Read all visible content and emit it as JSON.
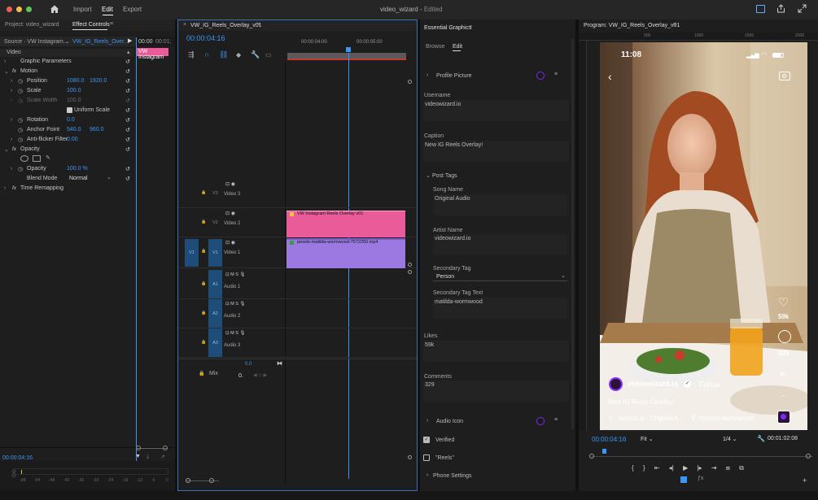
{
  "titlebar": {
    "import": "Import",
    "edit": "Edit",
    "export": "Export",
    "project": "video_wizard",
    "sep": "-",
    "status": "Edited"
  },
  "project_panel": {
    "label": "Project: video_wizard",
    "effect_controls": "Effect Controls"
  },
  "effect_controls": {
    "source": "Source · VW Instagram...",
    "sequence": "VW_IG_Reels_Over...",
    "time1": "00:00",
    "time2": "00:01;",
    "clip_label": "VW Instagram",
    "section_video": "Video",
    "rows": [
      {
        "name": "Graphic Parameters",
        "v1": "",
        "v2": ""
      },
      {
        "name": "Motion",
        "v1": "",
        "v2": ""
      },
      {
        "name": "Position",
        "v1": "1080.0",
        "v2": "1920.0"
      },
      {
        "name": "Scale",
        "v1": "100.0",
        "v2": ""
      },
      {
        "name": "Scale Width",
        "v1": "100.0",
        "v2": ""
      },
      {
        "name": "Uniform Scale",
        "v1": "",
        "v2": ""
      },
      {
        "name": "Rotation",
        "v1": "0.0",
        "v2": ""
      },
      {
        "name": "Anchor Point",
        "v1": "540.0",
        "v2": "960.0"
      },
      {
        "name": "Anti-flicker Filter",
        "v1": "0.00",
        "v2": ""
      },
      {
        "name": "Opacity",
        "v1": "",
        "v2": ""
      },
      {
        "name": "Opacity",
        "v1": "100.0 %",
        "v2": ""
      },
      {
        "name": "Blend Mode",
        "v1": "Normal",
        "v2": ""
      },
      {
        "name": "Time Remapping",
        "v1": "",
        "v2": ""
      }
    ],
    "timecode": "00:00:04:16",
    "meter": [
      "-dB",
      "-54",
      "-48",
      "-42",
      "-36",
      "-30",
      "-24",
      "-18",
      "-12",
      "-6",
      "0"
    ]
  },
  "timeline": {
    "tab": "VW_IG_Reels_Overlay_v01",
    "timecode": "00:00:04:16",
    "ruler1": "00:00:04:00",
    "ruler2": "00:00:05:00",
    "tracks": [
      {
        "id": "V3",
        "name": "Video 3"
      },
      {
        "id": "V2",
        "name": "Video 2"
      },
      {
        "id": "V1",
        "name": "Video 1",
        "src": "V1"
      },
      {
        "id": "A1",
        "name": "Audio 1"
      },
      {
        "id": "A2",
        "name": "Audio 2"
      },
      {
        "id": "A3",
        "name": "Audio 3"
      }
    ],
    "mix": "Mix",
    "mix_val": "0.0",
    "mix_val2": "0.",
    "clip_v2": "VW Instagram Reels Overlay v01",
    "clip_v1": "pexels-matilda-wormwood-7572250.mp4"
  },
  "essential_graphics": {
    "title": "Essential Graphics",
    "browse": "Browse",
    "edit": "Edit",
    "profile_picture": "Profile Picture",
    "username_label": "Username",
    "username": "videowizard.io",
    "caption_label": "Caption",
    "caption": "New IG Reels Overlay!",
    "post_tags": "Post Tags",
    "song_label": "Song Name",
    "song": "Original Audio",
    "artist_label": "Artist Name",
    "artist": "videowizard.io",
    "secondary_tag_label": "Secondary Tag",
    "secondary_tag": "Person",
    "secondary_tag_text_label": "Secondary Tag Text",
    "secondary_tag_text": "matilda-wormwood",
    "likes_label": "Likes",
    "likes": "59k",
    "comments_label": "Comments",
    "comments": "329",
    "audio_icon": "Audio Icon",
    "verified": "Verified",
    "reels": "\"Reels\"",
    "phone_settings": "Phone Settings"
  },
  "program": {
    "title": "Program: VW_IG_Reels_Overlay_v01",
    "ruler": [
      "500",
      "1000",
      "1500",
      "2000"
    ],
    "clock": "11:08",
    "likes": "59k",
    "comments": "329",
    "username": "videowizard.io",
    "follow": "Follow",
    "caption": "New IG Reels Overlay!",
    "audio": "wizard.io · Original A",
    "tag": "matilda-wormwood",
    "timecode": "00:00:04:16",
    "fit": "Fit",
    "quality": "1/4",
    "duration": "00:01:02:08"
  }
}
